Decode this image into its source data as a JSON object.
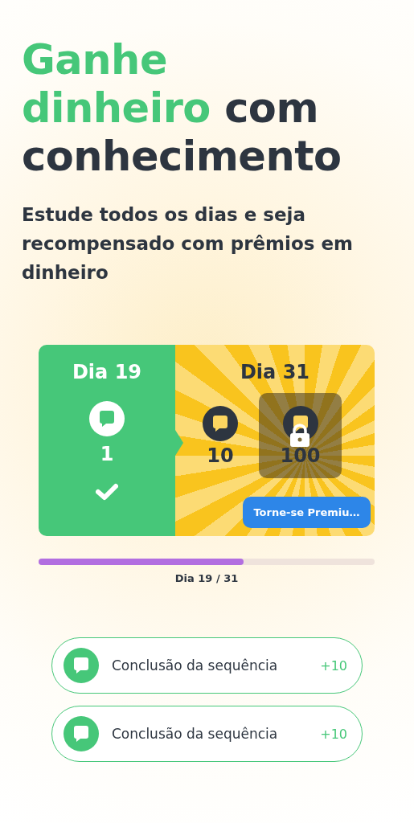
{
  "headline": {
    "lines": [
      [
        {
          "text": "Ganhe",
          "highlight": true
        }
      ],
      [
        {
          "text": "dinheiro",
          "highlight": true
        },
        {
          "text": "com",
          "highlight": false
        }
      ],
      [
        {
          "text": "conhecimento",
          "highlight": false
        }
      ]
    ]
  },
  "subtitle": "Estude todos os dias e seja recompensado com prêmios em dinheiro",
  "streak": {
    "current_day": {
      "label": "Dia 19",
      "reward": "1",
      "completed": true
    },
    "goal_day": {
      "label": "Dia 31",
      "rewards": [
        {
          "amount": "10",
          "locked": false
        },
        {
          "amount": "100",
          "locked": true
        }
      ],
      "button": "Torne-se Premiu…"
    }
  },
  "progress": {
    "level": 0.61,
    "label": "Dia 19 / 31"
  },
  "rewards": [
    {
      "label": "Conclusão da sequência",
      "points": "+10"
    },
    {
      "label": "Conclusão da sequência",
      "points": "+10"
    }
  ]
}
